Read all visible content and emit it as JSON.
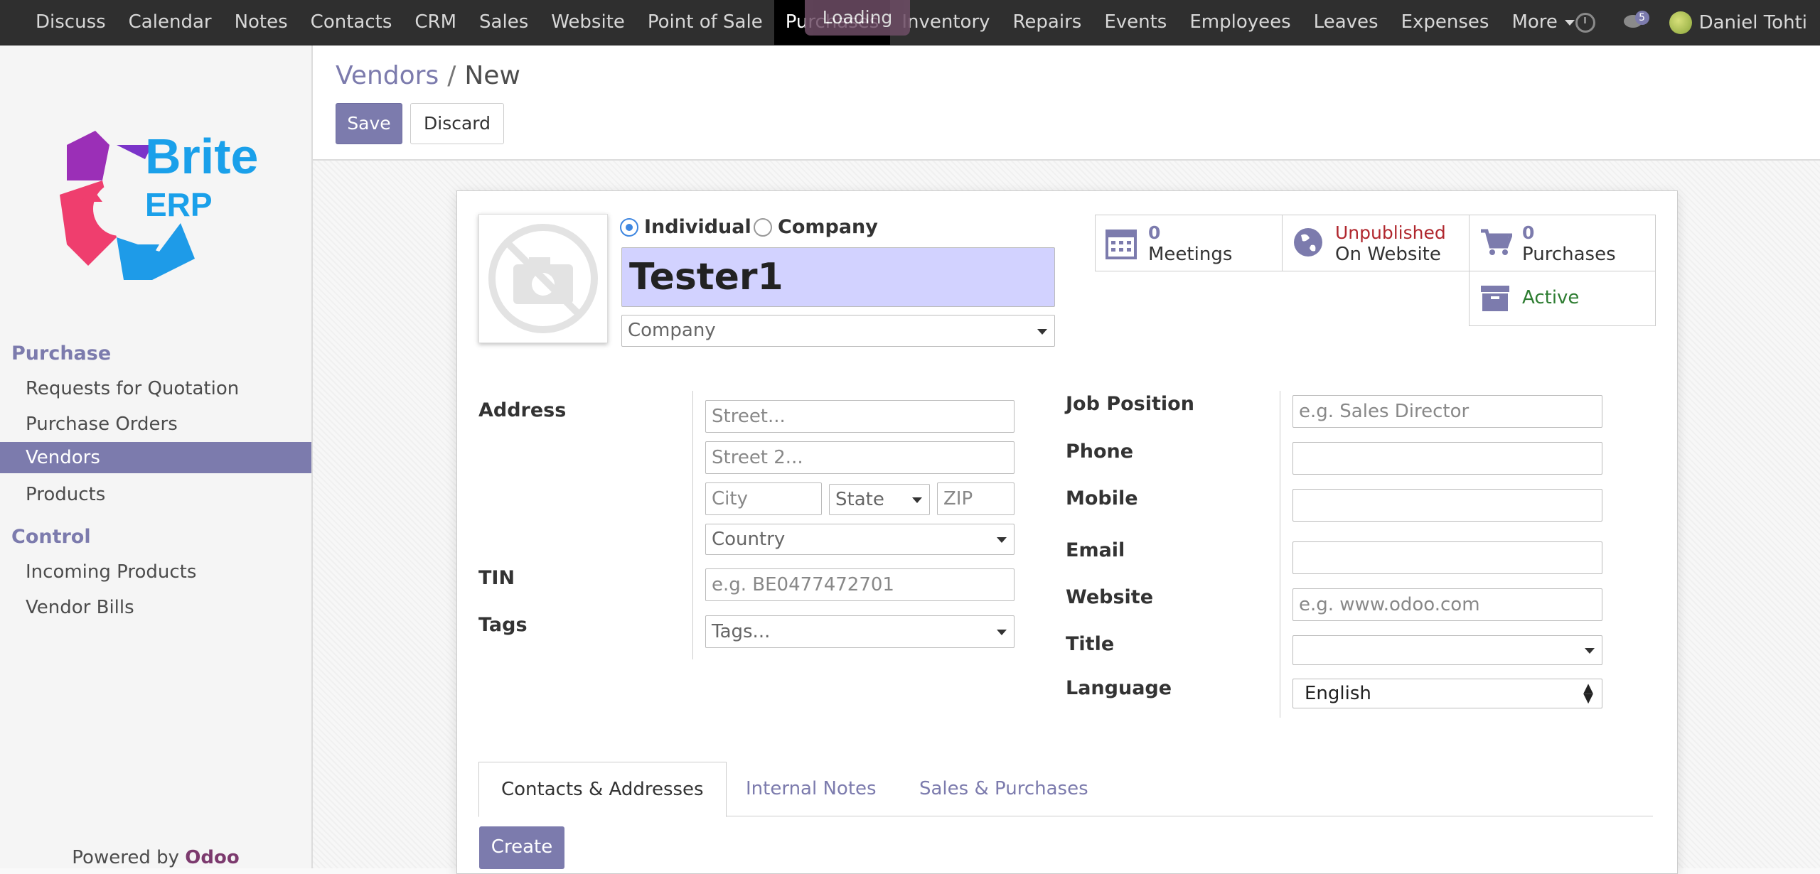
{
  "navbar": {
    "menu": [
      "Discuss",
      "Calendar",
      "Notes",
      "Contacts",
      "CRM",
      "Sales",
      "Website",
      "Point of Sale",
      "Purchases",
      "Inventory",
      "Repairs",
      "Events",
      "Employees",
      "Leaves",
      "Expenses",
      "More"
    ],
    "active": "Purchases",
    "loading": "Loading",
    "chat_count": "5",
    "user": "Daniel Tohti"
  },
  "sidebar": {
    "logo_text_1": "Brite",
    "logo_text_2": "ERP",
    "sections": [
      {
        "title": "Purchase",
        "items": [
          "Requests for Quotation",
          "Purchase Orders",
          "Vendors",
          "Products"
        ]
      },
      {
        "title": "Control",
        "items": [
          "Incoming Products",
          "Vendor Bills"
        ]
      }
    ],
    "active_item": "Vendors",
    "powered_by": "Powered by",
    "powered_brand": "Odoo"
  },
  "control_panel": {
    "breadcrumb_parent": "Vendors",
    "breadcrumb_separator": "/",
    "breadcrumb_current": "New",
    "save_label": "Save",
    "discard_label": "Discard"
  },
  "form": {
    "type_individual": "Individual",
    "type_company": "Company",
    "selected_type": "Individual",
    "name_value": "Tester1",
    "company_placeholder": "Company",
    "stats": {
      "meetings_count": "0",
      "meetings_label": "Meetings",
      "website_status": "Unpublished",
      "website_label": "On Website",
      "purchases_count": "0",
      "purchases_label": "Purchases",
      "active_label": "Active"
    },
    "labels": {
      "address": "Address",
      "tin": "TIN",
      "tags": "Tags",
      "job_position": "Job Position",
      "phone": "Phone",
      "mobile": "Mobile",
      "email": "Email",
      "website": "Website",
      "title": "Title",
      "language": "Language"
    },
    "placeholders": {
      "street": "Street...",
      "street2": "Street 2...",
      "city": "City",
      "state": "State",
      "zip": "ZIP",
      "country": "Country",
      "tin": "e.g. BE0477472701",
      "tags": "Tags...",
      "job_position": "e.g. Sales Director",
      "website": "e.g. www.odoo.com"
    },
    "values": {
      "phone": "",
      "mobile": "",
      "email": "",
      "title": "",
      "language": "English"
    },
    "tabs": [
      "Contacts & Addresses",
      "Internal Notes",
      "Sales & Purchases"
    ],
    "active_tab": "Contacts & Addresses",
    "create_label": "Create"
  },
  "colors": {
    "accent": "#7c7bad",
    "name_field_bg": "#d2d2ff",
    "unpublished": "#b0272e",
    "active_green": "#2e7d32"
  }
}
